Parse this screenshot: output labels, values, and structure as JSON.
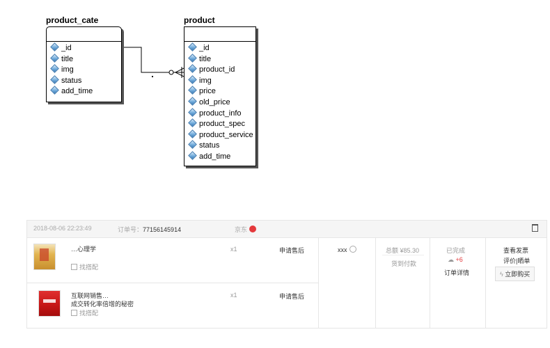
{
  "diagram": {
    "entities": [
      {
        "name": "product_cate",
        "fields": [
          "_id",
          "title",
          "img",
          "status",
          "add_time"
        ]
      },
      {
        "name": "product",
        "fields": [
          "_id",
          "title",
          "product_id",
          "img",
          "price",
          "old_price",
          "product_info",
          "product_spec",
          "product_service",
          "status",
          "add_time"
        ]
      }
    ],
    "relationship": {
      "from": "product_cate",
      "to": "product",
      "cardinality": "one-to-many"
    }
  },
  "order": {
    "datetime": "2018-08-06 22:23:49",
    "order_no_label": "订单号：",
    "order_no": "77156145914",
    "shop": "京东",
    "items": [
      {
        "title": "…心理学",
        "qty": "x1",
        "action": "申请售后",
        "match": "找搭配",
        "cover_color": "#e2b450"
      },
      {
        "title_line1": "互联网销售…",
        "title_line2": "成交转化率倍增的秘密",
        "qty": "x1",
        "action": "申请售后",
        "match": "找搭配",
        "cover_color": "#c41515"
      }
    ],
    "buyer": "xxx",
    "total": "总额 ¥85.30",
    "payment": "货到付款",
    "status": "已完成",
    "points": "+6",
    "detail_link": "订单详情",
    "actions": {
      "invoice": "查看发票",
      "review": "评价|晒单",
      "rebuy": "立即购买"
    }
  }
}
